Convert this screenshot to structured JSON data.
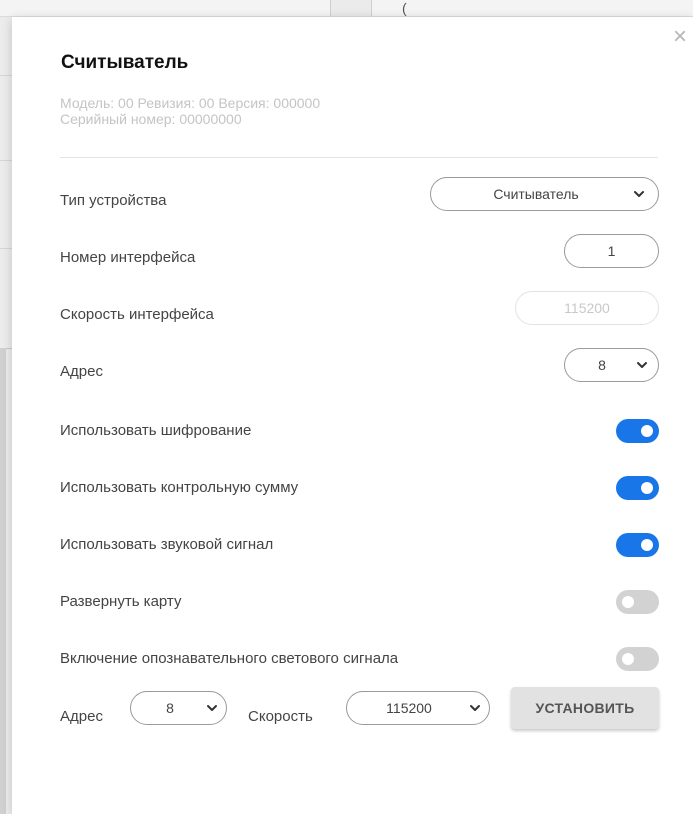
{
  "dialog": {
    "title": "Считыватель",
    "meta_line1": "Модель: 00 Ревизия: 00 Версия: 000000",
    "meta_line2": "Серийный номер: 00000000",
    "close_glyph": "×"
  },
  "fields": {
    "device_type": {
      "label": "Тип устройства",
      "value": "Считыватель"
    },
    "interface_number": {
      "label": "Номер интерфейса",
      "value": "1"
    },
    "interface_speed": {
      "label": "Скорость интерфейса",
      "value": "115200"
    },
    "address": {
      "label": "Адрес",
      "value": "8"
    }
  },
  "toggles": [
    {
      "label": "Использовать шифрование",
      "on": true
    },
    {
      "label": "Использовать контрольную сумму",
      "on": true
    },
    {
      "label": "Использовать звуковой сигнал",
      "on": true
    },
    {
      "label": "Развернуть карту",
      "on": false
    },
    {
      "label": "Включение опознавательного светового сигнала",
      "on": false
    }
  ],
  "footer": {
    "address_label": "Адрес",
    "address_value": "8",
    "speed_label": "Скорость",
    "speed_value": "115200",
    "set_button": "УСТАНОВИТЬ"
  },
  "colors": {
    "toggle_on": "#1976e8",
    "toggle_off": "#d2d2d2",
    "button_bg": "#e2e2e2"
  },
  "icons": {
    "close": "close-icon",
    "dropdown": "chevron-down-icon"
  }
}
